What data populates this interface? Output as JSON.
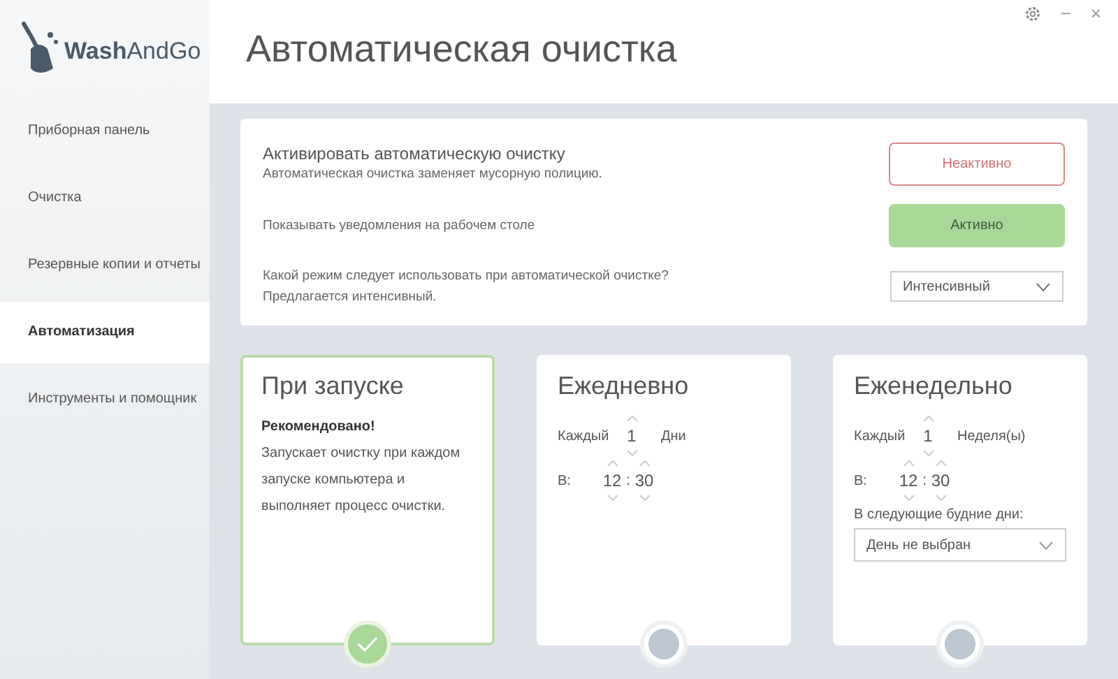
{
  "app": {
    "name_bold": "Wash",
    "name_light": "AndGo"
  },
  "window_controls": [
    "−",
    "×"
  ],
  "sidebar": {
    "items": [
      {
        "label": "Приборная панель",
        "selected": false
      },
      {
        "label": "Очистка",
        "selected": false
      },
      {
        "label": "Резервные копии и отчеты",
        "selected": false
      },
      {
        "label": "Автоматизация",
        "selected": true
      },
      {
        "label": "Инструменты и помощник",
        "selected": false
      }
    ]
  },
  "page_title": "Автоматическая очистка",
  "settings": [
    {
      "kind": "toggle",
      "title": "Активировать автоматическую очистку",
      "lines": [
        "Автоматическая очистка заменяет мусорную полицию."
      ],
      "on": false,
      "value": "Неактивно"
    },
    {
      "kind": "toggle",
      "lines": [
        "Показывать уведомления на рабочем столе"
      ],
      "on": true,
      "value": "Активно"
    },
    {
      "kind": "select",
      "lines": [
        "Какой режим следует использовать при автоматической очистке?",
        "Предлагается интенсивный."
      ],
      "value": "Интенсивный"
    }
  ],
  "schedules": [
    {
      "kind": "startup",
      "title": "При запуске",
      "note": "Рекомендовано!",
      "text": "Запускает очистку при каждом запуске компьютера и выполняет процесс очистки.",
      "selected": true
    },
    {
      "kind": "daily",
      "title": "Ежедневно",
      "every_label": "Каждый",
      "count": "1",
      "unit": "Дни",
      "at_label": "В:",
      "hour": "12",
      "separator": ":",
      "minute": "30",
      "selected": false
    },
    {
      "kind": "weekly",
      "title": "Еженедельно",
      "every_label": "Каждый",
      "count": "1",
      "unit": "Неделя(ы)",
      "at_label": "В:",
      "hour": "12",
      "separator": ":",
      "minute": "30",
      "days_label": "В следующие будние дни:",
      "days_value": "День не выбран",
      "selected": false
    }
  ]
}
